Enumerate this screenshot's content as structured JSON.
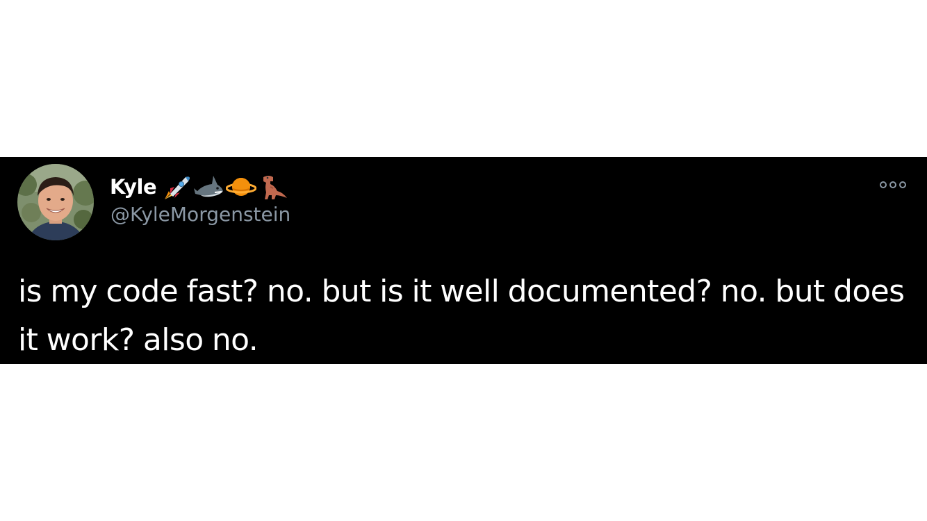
{
  "tweet": {
    "author": {
      "display_name": "Kyle",
      "handle": "@KyleMorgenstein",
      "name_emojis": [
        "rocket-icon",
        "shark-icon",
        "ringed-planet-icon",
        "t-rex-icon"
      ]
    },
    "text": "is my code fast? no. but is it well documented? no. but does it work? also no.",
    "more_icon": "more-options-icon"
  },
  "colors": {
    "page_background": "#ffffff",
    "tweet_background": "#000000",
    "text_primary": "#ffffff",
    "text_secondary": "#8b98a5"
  }
}
